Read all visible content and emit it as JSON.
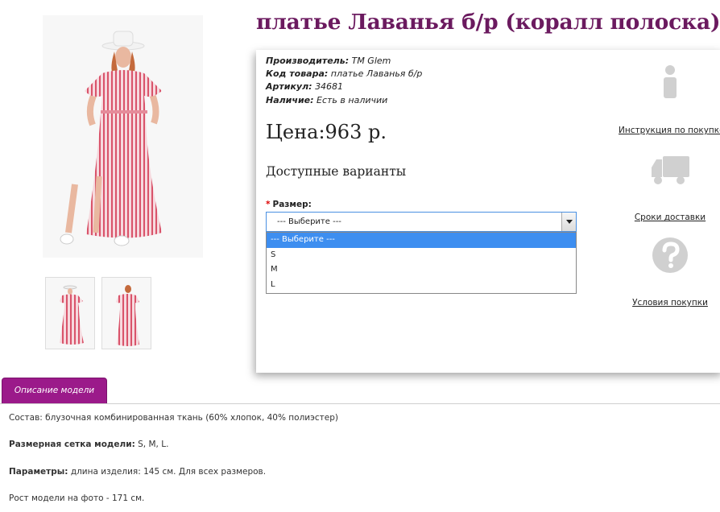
{
  "product": {
    "title": "платье Лаванья б/р (коралл полоска)",
    "specs": [
      {
        "key": "Производитель:",
        "value": "TM Glem"
      },
      {
        "key": "Код товара:",
        "value": "платье Лаванья б/р"
      },
      {
        "key": "Артикул:",
        "value": "34681"
      },
      {
        "key": "Наличие:",
        "value": "Есть в наличии"
      }
    ],
    "price": "Цена:963 р.",
    "variants_heading": "Доступные варианты",
    "size_label": "Размер:",
    "size_required_mark": "*",
    "size_select": {
      "selected": "--- Выберите ---",
      "options": [
        "--- Выберите ---",
        "S",
        "M",
        "L"
      ]
    }
  },
  "side_links": {
    "instructions": "Инструкция по покупке",
    "delivery": "Сроки доставки",
    "terms": "Условия покупки"
  },
  "tabs": {
    "description": "Описание модели"
  },
  "description": {
    "composition": "Состав: блузочная комбинированная ткань (60% хлопок, 40% полиэстер)",
    "size_grid_key": "Размерная сетка модели:",
    "size_grid_value": "S, M, L.",
    "params_key": "Параметры:",
    "params_value": "длина изделия: 145 см. Для всех размеров.",
    "model_height": "Рост модели на фото - 171 см."
  },
  "colors": {
    "title": "#6b1a5f",
    "tab": "#9b1a8a",
    "selected_option": "#3d8ef0",
    "dress_stripe": "#d9536a"
  },
  "icons": [
    "info-icon",
    "truck-icon",
    "question-icon"
  ]
}
